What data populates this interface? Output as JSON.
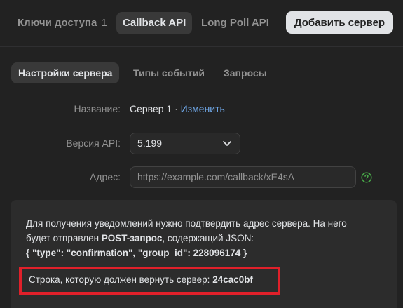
{
  "top_tabs": [
    {
      "label": "Ключи доступа",
      "count": "1"
    },
    {
      "label": "Callback API"
    },
    {
      "label": "Long Poll API"
    }
  ],
  "add_server_label": "Добавить сервер",
  "sub_tabs": [
    {
      "label": "Настройки сервера"
    },
    {
      "label": "Типы событий"
    },
    {
      "label": "Запросы"
    }
  ],
  "form": {
    "name_label": "Название:",
    "name_value": "Сервер 1",
    "separator": " · ",
    "edit_link": "Изменить",
    "api_version_label": "Версия API:",
    "api_version_value": "5.199",
    "address_label": "Адрес:",
    "address_placeholder": "https://example.com/callback/xE4sA"
  },
  "info": {
    "line1": "Для получения уведомлений нужно подтвердить адрес сервера. На него",
    "line2_pre": "будет отправлен ",
    "line2_bold": "POST-запрос",
    "line2_post": ", содержащий JSON:",
    "json_line": "{ \"type\": \"confirmation\", \"group_id\": 228096174 }",
    "confirm_label": "Строка, которую должен вернуть сервер: ",
    "confirm_code": "24cac0bf"
  },
  "colors": {
    "accent_link": "#71aaeb",
    "help_icon": "#4bb34b",
    "highlight_border": "#e0202a"
  }
}
